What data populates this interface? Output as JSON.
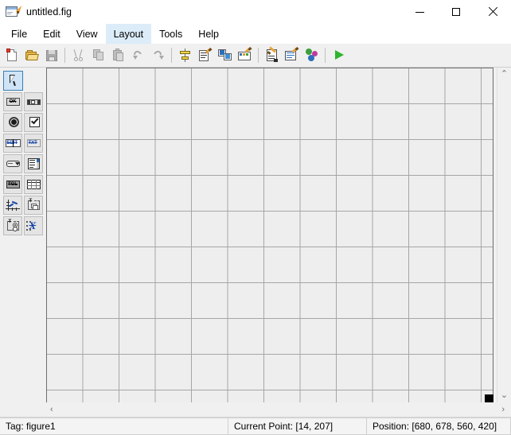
{
  "window": {
    "title": "untitled.fig",
    "icon": "guide-figure-icon",
    "controls": {
      "minimize": "–",
      "maximize": "☐",
      "close": "✕"
    }
  },
  "menubar": {
    "items": [
      {
        "label": "File",
        "name": "menu-file",
        "active": false
      },
      {
        "label": "Edit",
        "name": "menu-edit",
        "active": false
      },
      {
        "label": "View",
        "name": "menu-view",
        "active": false
      },
      {
        "label": "Layout",
        "name": "menu-layout",
        "active": true
      },
      {
        "label": "Tools",
        "name": "menu-tools",
        "active": false
      },
      {
        "label": "Help",
        "name": "menu-help",
        "active": false
      }
    ]
  },
  "toolbar": {
    "buttons": [
      {
        "name": "new-figure-button",
        "tooltip": "New",
        "enabled": true
      },
      {
        "name": "open-figure-button",
        "tooltip": "Open",
        "enabled": true
      },
      {
        "name": "save-figure-button",
        "tooltip": "Save",
        "enabled": false
      },
      {
        "name": "cut-button",
        "tooltip": "Cut",
        "enabled": false
      },
      {
        "name": "copy-button",
        "tooltip": "Copy",
        "enabled": false
      },
      {
        "name": "paste-button",
        "tooltip": "Paste",
        "enabled": false
      },
      {
        "name": "undo-button",
        "tooltip": "Undo",
        "enabled": false
      },
      {
        "name": "redo-button",
        "tooltip": "Redo",
        "enabled": false
      },
      {
        "name": "align-objects-button",
        "tooltip": "Align Objects",
        "enabled": true
      },
      {
        "name": "menu-editor-button",
        "tooltip": "Menu Editor",
        "enabled": true
      },
      {
        "name": "tab-order-editor-button",
        "tooltip": "Tab Order Editor",
        "enabled": true
      },
      {
        "name": "toolbar-editor-button",
        "tooltip": "Toolbar Editor",
        "enabled": true
      },
      {
        "name": "m-file-editor-button",
        "tooltip": "M-file Editor",
        "enabled": true
      },
      {
        "name": "property-inspector-button",
        "tooltip": "Property Inspector",
        "enabled": true
      },
      {
        "name": "object-browser-button",
        "tooltip": "Object Browser",
        "enabled": true
      },
      {
        "name": "run-figure-button",
        "tooltip": "Run",
        "enabled": true
      }
    ]
  },
  "palette": {
    "rows": [
      [
        {
          "name": "tool-select-arrow",
          "label": "Select",
          "selected": true
        }
      ],
      [
        {
          "name": "tool-push-button",
          "label": "Push Button",
          "glyph": "OK"
        },
        {
          "name": "tool-slider",
          "label": "Slider",
          "glyph": ""
        }
      ],
      [
        {
          "name": "tool-radio-button",
          "label": "Radio Button",
          "glyph": ""
        },
        {
          "name": "tool-check-box",
          "label": "Check Box",
          "glyph": ""
        }
      ],
      [
        {
          "name": "tool-edit-text",
          "label": "Edit Text",
          "glyph": "EDIT"
        },
        {
          "name": "tool-static-text",
          "label": "Static Text",
          "glyph": "TXT"
        }
      ],
      [
        {
          "name": "tool-pop-up-menu",
          "label": "Pop-up Menu",
          "glyph": ""
        },
        {
          "name": "tool-list-box",
          "label": "List Box",
          "glyph": ""
        }
      ],
      [
        {
          "name": "tool-toggle-button",
          "label": "Toggle Button",
          "glyph": "TGL"
        },
        {
          "name": "tool-table",
          "label": "Table",
          "glyph": ""
        }
      ],
      [
        {
          "name": "tool-axes",
          "label": "Axes",
          "glyph": ""
        },
        {
          "name": "tool-panel",
          "label": "Panel",
          "glyph": "T"
        }
      ],
      [
        {
          "name": "tool-button-group",
          "label": "Button Group",
          "glyph": "T"
        },
        {
          "name": "tool-activex-control",
          "label": "ActiveX Control",
          "glyph": "X"
        }
      ]
    ]
  },
  "canvas": {
    "name": "figure-layout-canvas",
    "grid_visible": true,
    "grid_size_px": 45,
    "resize_handle": "bottom-right-resize-handle"
  },
  "scrollbars": {
    "vertical": {
      "up": "⌃",
      "down": "⌄"
    },
    "horizontal": {
      "left": "‹",
      "right": "›"
    }
  },
  "statusbar": {
    "tag": "Tag: figure1",
    "current_point": "Current Point:  [14, 207]",
    "position": "Position: [680, 678, 560, 420]"
  },
  "colors": {
    "accent": "#dcecf8",
    "canvas_bg": "#eeeeee",
    "grid_line": "#a6a6a6",
    "chrome_bg": "#f0f0f0",
    "run_green": "#2db52d"
  }
}
